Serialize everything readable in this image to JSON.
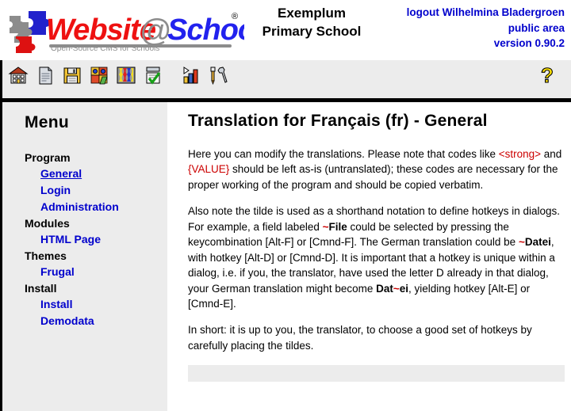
{
  "header": {
    "logo": {
      "alt": "Website@School logo",
      "word_website": "Website",
      "word_at": "@",
      "word_school": "School",
      "registered_mark": "®",
      "tagline": "Open-Source CMS for Schools"
    },
    "school_name_line1": "Exemplum",
    "school_name_line2": "Primary School",
    "account_lines": [
      "logout Wilhelmina Bladergroen",
      "public area",
      "version 0.90.2"
    ],
    "logout_label": "logout",
    "user_name": "Wilhelmina Bladergroen",
    "area_label": "public area",
    "version_label": "version 0.90.2",
    "link_color": "#0000cc"
  },
  "toolbar": {
    "items": [
      {
        "name": "home-icon",
        "title": "Home"
      },
      {
        "name": "page-icon",
        "title": "Page"
      },
      {
        "name": "save-icon",
        "title": "Save"
      },
      {
        "name": "modules-icon",
        "title": "Modules"
      },
      {
        "name": "themes-icon",
        "title": "Themes"
      },
      {
        "name": "tasks-icon",
        "title": "Tasks"
      },
      {
        "name": "statistics-icon",
        "title": "Statistics"
      },
      {
        "name": "tools-icon",
        "title": "Tools"
      }
    ],
    "help": {
      "name": "help-icon",
      "glyph": "?",
      "color": "#ffe200"
    }
  },
  "sidebar": {
    "title": "Menu",
    "groups": [
      {
        "label": "Program",
        "links": [
          {
            "label": "General",
            "active": true
          },
          {
            "label": "Login",
            "active": false
          },
          {
            "label": "Administration",
            "active": false
          }
        ]
      },
      {
        "label": "Modules",
        "links": [
          {
            "label": "HTML Page",
            "active": false
          }
        ]
      },
      {
        "label": "Themes",
        "links": [
          {
            "label": "Frugal",
            "active": false
          }
        ]
      },
      {
        "label": "Install",
        "links": [
          {
            "label": "Install",
            "active": false
          },
          {
            "label": "Demodata",
            "active": false
          }
        ]
      }
    ]
  },
  "content": {
    "heading": "Translation for Français (fr) - General",
    "paragraph1": {
      "part1": "Here you can modify the translations. Please note that codes like ",
      "code1": "<strong>",
      "part2": " and ",
      "code2": "{VALUE}",
      "part3": " should be left as-is (untranslated); these codes are necessary for the proper working of the program and should be copied verbatim."
    },
    "paragraph2": {
      "part1": "Also note the tilde is used as a shorthand notation to define hotkeys in dialogs. For example, a field labeled ",
      "hot1_tilde": "~",
      "hot1_word": "File",
      "part2": " could be selected by pressing the keycombination [Alt-F] or [Cmnd-F]. The German translation could be ",
      "hot2_tilde": "~",
      "hot2_word": "Datei",
      "part3": ", with hotkey [Alt-D] or [Cmnd-D]. It is important that a hotkey is unique within a dialog, i.e. if you, the translator, have used the letter D already in that dialog, your German translation might become ",
      "hot3_pre": "Dat",
      "hot3_tilde": "~",
      "hot3_post": "ei",
      "part4": ", yielding hotkey [Alt-E] or [Cmnd-E]."
    },
    "paragraph3": "In short: it is up to you, the translator, to choose a good set of hotkeys by carefully placing the tildes.",
    "code_color": "#cc0000"
  }
}
